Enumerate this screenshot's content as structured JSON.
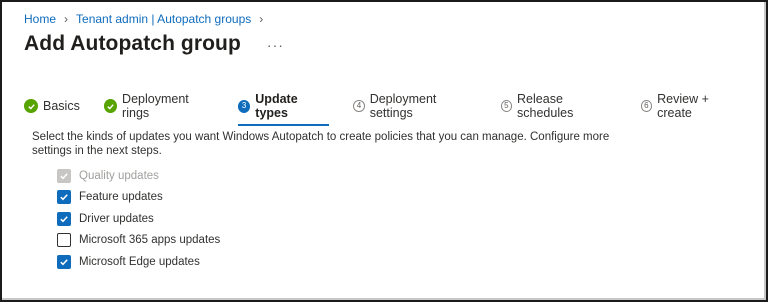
{
  "breadcrumb": {
    "home": "Home",
    "tenant": "Tenant admin | Autopatch groups"
  },
  "header": {
    "title": "Add Autopatch group",
    "more": "···"
  },
  "steps": [
    {
      "label": "Basics",
      "state": "done",
      "number": "1"
    },
    {
      "label": "Deployment rings",
      "state": "done",
      "number": "2"
    },
    {
      "label": "Update types",
      "state": "active",
      "number": "3"
    },
    {
      "label": "Deployment settings",
      "state": "pending",
      "number": "4"
    },
    {
      "label": "Release schedules",
      "state": "pending",
      "number": "5"
    },
    {
      "label": "Review + create",
      "state": "pending",
      "number": "6"
    }
  ],
  "description": "Select the kinds of updates you want Windows Autopatch to create policies that you can manage. Configure more settings in the next steps.",
  "options": [
    {
      "label": "Quality updates",
      "checked": true,
      "disabled": true
    },
    {
      "label": "Feature updates",
      "checked": true,
      "disabled": false
    },
    {
      "label": "Driver updates",
      "checked": true,
      "disabled": false
    },
    {
      "label": "Microsoft 365 apps updates",
      "checked": false,
      "disabled": false
    },
    {
      "label": "Microsoft Edge updates",
      "checked": true,
      "disabled": false
    }
  ],
  "colors": {
    "accent": "#0f6cbd",
    "success": "#57a300"
  }
}
